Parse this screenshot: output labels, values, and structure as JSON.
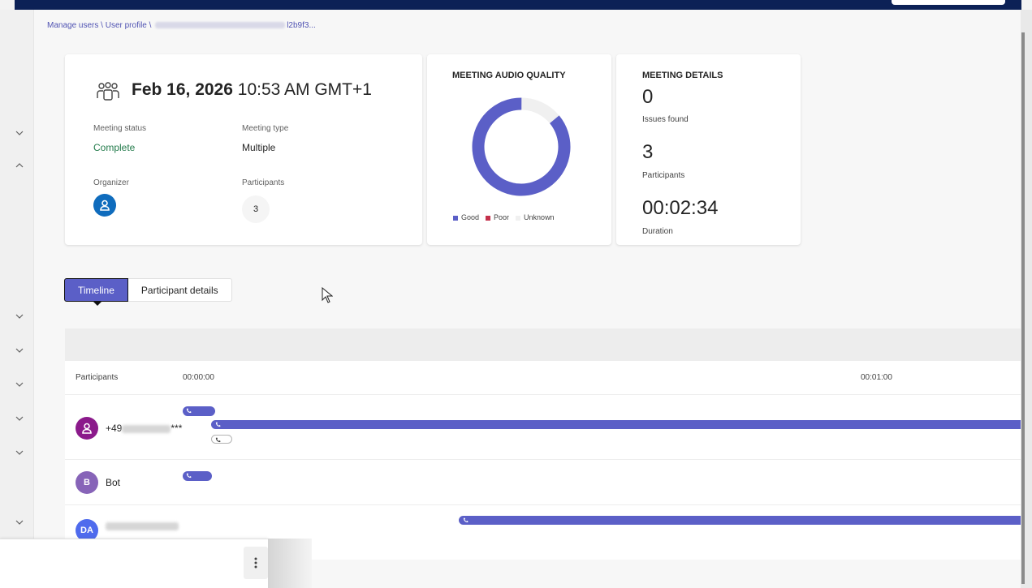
{
  "breadcrumb": {
    "item1": "Manage users",
    "sep1": " \\ ",
    "item2": "User profile",
    "sep2": " \\ ",
    "tail": "l2b9f3..."
  },
  "summary": {
    "date": "Feb 16, 2026",
    "time": "10:53 AM GMT+1",
    "status_label": "Meeting status",
    "status_value": "Complete",
    "type_label": "Meeting type",
    "type_value": "Multiple",
    "organizer_label": "Organizer",
    "participants_label": "Participants",
    "participants_value": "3"
  },
  "audio": {
    "title": "MEETING AUDIO QUALITY",
    "good_fraction": 0.86,
    "unknown_fraction": 0.14,
    "legend": [
      "Good",
      "Poor",
      "Unknown"
    ],
    "colors": {
      "good": "#5b5fc7",
      "poor": "#c4314b",
      "unknown": "#f0f0f0"
    }
  },
  "details": {
    "title": "MEETING DETAILS",
    "issues_value": "0",
    "issues_label": "Issues found",
    "participants_value": "3",
    "participants_label": "Participants",
    "duration_value": "00:02:34",
    "duration_label": "Duration"
  },
  "tabs": [
    {
      "label": "Timeline",
      "active": true
    },
    {
      "label": "Participant details",
      "active": false
    }
  ],
  "timeline": {
    "col_participants": "Participants",
    "tick_start": "00:00:00",
    "tick_minute": "00:01:00",
    "rows": [
      {
        "name_prefix": "+49",
        "name_suffix": "***",
        "avatar_color": "#8b1a8b",
        "avatar_icon": "person-icon"
      },
      {
        "name": "Bot",
        "initial": "B",
        "avatar_color": "#8764b8"
      },
      {
        "initials": "DA",
        "avatar_color": "#4f6bed"
      }
    ]
  },
  "colors": {
    "accent": "#5b5fc7",
    "topbar": "#0c2156",
    "complete": "#237b4b"
  }
}
